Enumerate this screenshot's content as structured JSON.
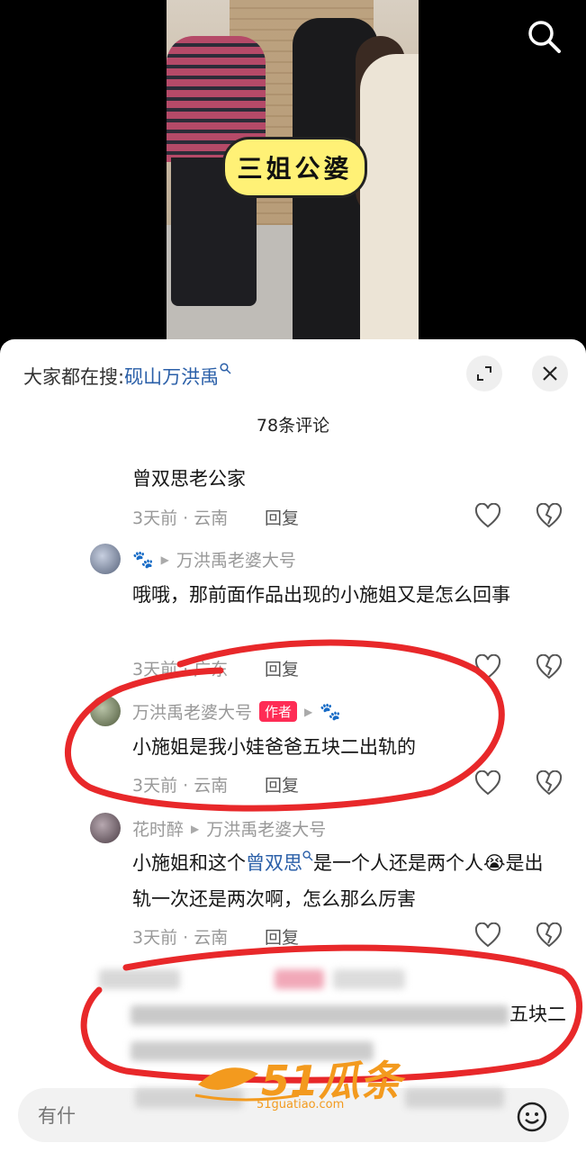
{
  "video": {
    "caption_sticker": "三姐公婆"
  },
  "sheet": {
    "suggest_prefix": "大家都在搜:",
    "suggest_keyword": "砚山万洪禹",
    "comment_count": "78条评论"
  },
  "comments": [
    {
      "text": "曾双思老公家",
      "time_loc": "3天前 · 云南",
      "reply": "回复"
    },
    {
      "user": "🐾",
      "reply_to": "万洪禹老婆大号",
      "text": "哦哦，那前面作品出现的小施姐又是怎么回事",
      "time_loc": "3天前 · 广东",
      "reply": "回复"
    },
    {
      "user": "万洪禹老婆大号",
      "badge": "作者",
      "reply_to": "🐾",
      "text": "小施姐是我小娃爸爸五块二出轨的",
      "time_loc": "3天前 · 云南",
      "reply": "回复"
    },
    {
      "user": "花时醉",
      "reply_to": "万洪禹老婆大号",
      "text_before": "小施姐和这个",
      "text_keyword": "曾双思",
      "text_after": "是一个人还是两个人😭是出轨一次还是两次啊，怎么那么厉害",
      "time_loc": "3天前 · 云南",
      "reply": "回复"
    },
    {
      "partial_text": "五块二"
    }
  ],
  "input": {
    "placeholder": "有什"
  },
  "watermark": {
    "brand": "51瓜条",
    "url": "51guatiao.com"
  },
  "colors": {
    "author_badge": "#fe2c55",
    "keyword": "#2a5fa8",
    "annotation_red": "#e8282a",
    "watermark": "#f39a1e"
  }
}
